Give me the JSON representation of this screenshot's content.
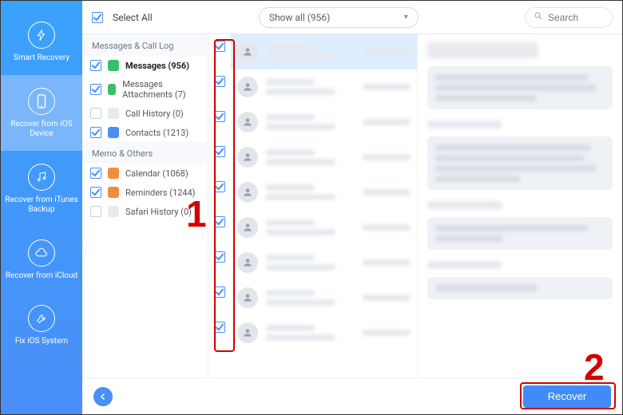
{
  "sidebar": {
    "items": [
      {
        "label": "Smart Recovery"
      },
      {
        "label": "Recover from iOS Device"
      },
      {
        "label": "Recover from iTunes Backup"
      },
      {
        "label": "Recover from iCloud"
      },
      {
        "label": "Fix iOS System"
      }
    ]
  },
  "topbar": {
    "select_all": "Select All",
    "filter": "Show all (956)",
    "search_placeholder": "Search"
  },
  "tree": {
    "groups": [
      {
        "title": "Messages & Call Log",
        "items": [
          {
            "label": "Messages (956)",
            "checked": true,
            "color": "#36c06b",
            "selected": true
          },
          {
            "label": "Messages Attachments (7)",
            "checked": true,
            "color": "#36c06b"
          },
          {
            "label": "Call History (0)",
            "checked": false,
            "color": "#36c06b"
          },
          {
            "label": "Contacts (1213)",
            "checked": true,
            "color": "#4a8ef8"
          }
        ]
      },
      {
        "title": "Memo & Others",
        "items": [
          {
            "label": "Calendar (1068)",
            "checked": true,
            "color": "#f28c3b"
          },
          {
            "label": "Reminders (1244)",
            "checked": true,
            "color": "#f28c3b"
          },
          {
            "label": "Safari History (0)",
            "checked": false,
            "color": "#4a8ef8"
          }
        ]
      }
    ]
  },
  "footer": {
    "recover": "Recover"
  },
  "annotations": {
    "marker1": "1",
    "marker2": "2"
  }
}
